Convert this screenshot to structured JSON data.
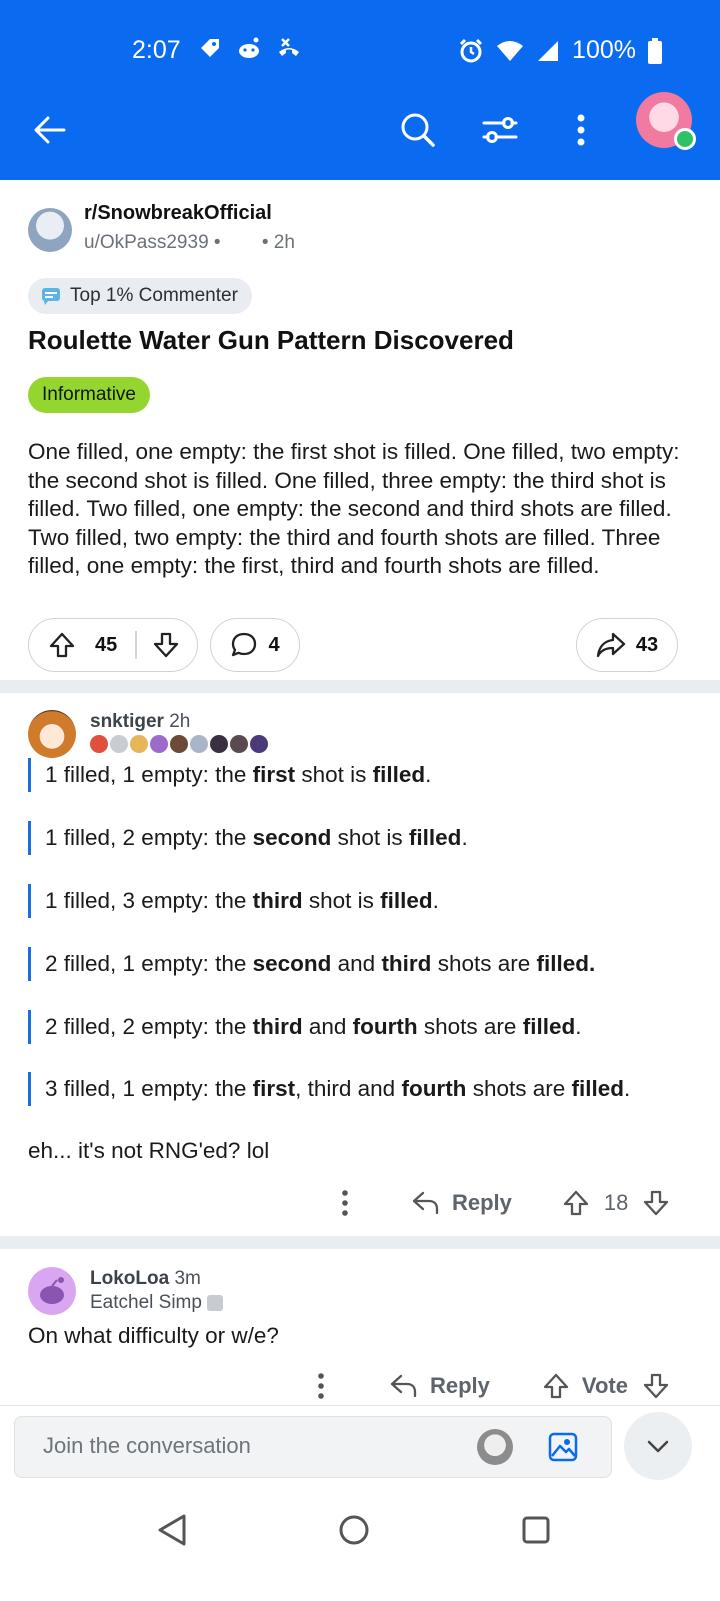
{
  "status": {
    "time": "2:07",
    "battery": "100%"
  },
  "post": {
    "subreddit": "r/SnowbreakOfficial",
    "user": "u/OkPass2939",
    "dot": "•",
    "age": "• 2h",
    "flair": "Top 1% Commenter",
    "title": "Roulette Water Gun Pattern Discovered",
    "tag": "Informative",
    "tag_color": "#94d62f",
    "body": "One filled, one empty: the first shot is filled. One filled, two empty: the second shot is filled. One filled, three empty: the third shot is filled. Two filled, one empty: the second and third shots are filled. Two filled, two empty: the third and fourth shots are filled. Three filled, one empty: the first, third and fourth shots are filled.",
    "upvotes": "45",
    "comments": "4",
    "shares": "43"
  },
  "comment1": {
    "user": "snktiger",
    "age": "2h",
    "lines": [
      {
        "a": "1 filled, 1 empty: the ",
        "b": "first",
        "c": " shot is ",
        "d": "filled",
        "e": "."
      },
      {
        "a": "1 filled, 2 empty: the ",
        "b": "second",
        "c": " shot is ",
        "d": "filled",
        "e": "."
      },
      {
        "a": "1 filled, 3 empty: the ",
        "b": "third",
        "c": " shot is ",
        "d": "filled",
        "e": "."
      },
      {
        "a": "2 filled, 1 empty: the ",
        "b": "second",
        "c": " and ",
        "d": "third",
        "e": " shots are ",
        "f": "filled."
      },
      {
        "a": "2 filled, 2 empty: the ",
        "b": "third",
        "c": " and ",
        "d": "fourth",
        "e": " shots are ",
        "f": "filled",
        "g": "."
      },
      {
        "a": "3 filled, 1 empty: the ",
        "b": "first",
        "c": ", third and ",
        "d": "fourth",
        "e": " shots are ",
        "f": "filled",
        "g": "."
      }
    ],
    "text": "eh... it's not RNG'ed? lol",
    "reply": "Reply",
    "score": "18"
  },
  "comment2": {
    "user": "LokoLoa",
    "age": "3m",
    "flair": "Eatchel Simp",
    "text": "On what difficulty or w/e?",
    "reply": "Reply",
    "score": "Vote"
  },
  "composer": {
    "placeholder": "Join the conversation"
  }
}
